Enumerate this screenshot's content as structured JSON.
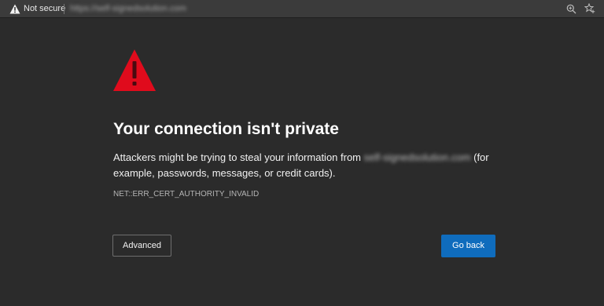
{
  "address_bar": {
    "security_label": "Not secure",
    "security_icon": "warning-triangle-icon",
    "url": "https://self-signedsolution.com",
    "zoom_icon": "zoom-icon",
    "favorites_icon": "add-favorite-icon"
  },
  "error_page": {
    "danger_icon": "red-warning-triangle-icon",
    "title": "Your connection isn't private",
    "description_before": "Attackers might be trying to steal your information from ",
    "host": "self-signedsolution.com",
    "description_after": " (for example, passwords, messages, or credit cards).",
    "error_code": "NET::ERR_CERT_AUTHORITY_INVALID",
    "advanced_label": "Advanced",
    "go_back_label": "Go back"
  },
  "colors": {
    "background": "#2b2b2b",
    "address_bar": "#3b3b3b",
    "danger_red": "#e00b1c",
    "primary_button": "#0f6cbd"
  }
}
